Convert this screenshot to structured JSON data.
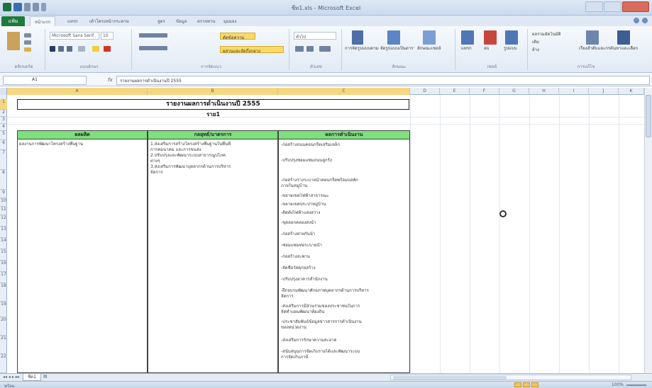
{
  "window": {
    "title": "ชีท1.xls - Microsoft Excel"
  },
  "ribbon": {
    "file_tab": "แฟ้ม",
    "tabs": [
      "หน้าแรก",
      "แทรก",
      "เค้าโครงหน้ากระดาษ",
      "สูตร",
      "ข้อมูล",
      "ตรวจทาน",
      "มุมมอง"
    ],
    "font_name": "Microsoft Sans Serif",
    "font_size": "10",
    "wrap_text": "ตัดข้อความ",
    "merge_center": "ผสานและจัดกึ่งกลาง",
    "number_format": "ทั่วไป",
    "groups": [
      "คลิปบอร์ด",
      "แบบอักษร",
      "การจัดแนว",
      "ตัวเลข",
      "ลักษณะ",
      "เซลล์",
      "การแก้ไข"
    ],
    "styles": [
      "การจัดรูปแบบตามเงื่อนไข",
      "จัดรูปแบบเป็นตาราง",
      "ลักษณะเซลล์"
    ],
    "cells": [
      "แทรก",
      "ลบ",
      "รูปแบบ"
    ],
    "editing": [
      "ผลรวมอัตโนมัติ",
      "เติม",
      "ล้าง",
      "เรียงลำดับและกรอง",
      "ค้นหาและเลือก"
    ]
  },
  "formula_bar": {
    "name_box": "A1",
    "fx": "fx",
    "formula": "รายงานผลการดำเนินงานปี 2555"
  },
  "columns": [
    "A",
    "B",
    "C",
    "D",
    "E",
    "F",
    "G",
    "H",
    "I",
    "J",
    "K"
  ],
  "rows": [
    "1",
    "2",
    "3",
    "4",
    "5",
    "6",
    "7",
    "8",
    "9",
    "10",
    "11",
    "12",
    "13",
    "14",
    "15",
    "16",
    "17",
    "18",
    "19",
    "20",
    "21",
    "22"
  ],
  "sheet": {
    "title": "รายงานผลการดำเนินงานปี 2555",
    "subtitle": "ราย1",
    "headers": [
      "ผลผลิต",
      "กลยุทธ์/มาตรการ",
      "ผลการดำเนินงาน"
    ],
    "col_a": [
      "ผลงานการพัฒนาโครงสร้างพื้นฐาน"
    ],
    "col_b": [
      "1.ส่งเสริมการสร้างโครงสร้างพื้นฐานในพื้นที่",
      "การคมนาคม และการขนส่ง",
      "2.ปรับปรุงและพัฒนาระบบสาธารณูปโภค",
      "ต่างๆ",
      "3.ส่งเสริมการพัฒนาบุคลากรด้านการบริหาร",
      "จัดการ"
    ],
    "col_c": [
      "-ก่อสร้างถนนคอนกรีตเสริมเหล็ก",
      "-ปรับปรุงซ่อมแซมถนนลูกรัง",
      "-ก่อสร้างรางระบายน้ำคอนกรีตพร้อมบ่อพัก",
      "ภายในหมู่บ้าน",
      "-ขยายเขตไฟฟ้าสาธารณะ",
      "-ขยายเขตประปาหมู่บ้าน",
      "-ติดตั้งไฟฟ้าแสงสว่าง",
      "-ขุดลอกคลองส่งน้ำ",
      "-ก่อสร้างฝายกั้นน้ำ",
      "-ซ่อมแซมท่อระบายน้ำ",
      "-ก่อสร้างสะพาน",
      "-จัดซื้อวัสดุก่อสร้าง",
      "-ปรับปรุงอาคารสำนักงาน",
      "-ฝึกอบรมพัฒนาศักยภาพบุคลากรด้านการบริหาร",
      "จัดการ",
      "-ส่งเสริมการมีส่วนร่วมของประชาชนในการ",
      "จัดทำแผนพัฒนาท้องถิ่น",
      "-ประชาสัมพันธ์ข้อมูลข่าวสารการดำเนินงาน",
      "ของหน่วยงาน",
      "-ส่งเสริมการรักษาความสะอาด",
      "-สนับสนุนการจัดเก็บรายได้และพัฒนาระบบ",
      "การจัดเก็บภาษี"
    ]
  },
  "sheet_tab": "ชีต1",
  "status": {
    "text": "พร้อม",
    "zoom": "100%"
  }
}
